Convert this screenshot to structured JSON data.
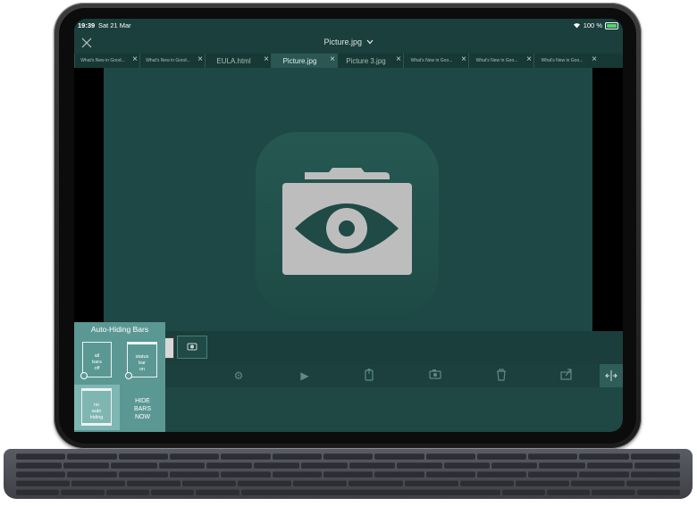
{
  "status_bar": {
    "time": "19:39",
    "date": "Sat 21 Mar",
    "battery": "100 %"
  },
  "header": {
    "title": "Picture.jpg"
  },
  "tabs": [
    {
      "label": "What's New in Good...",
      "size": "small",
      "active": false
    },
    {
      "label": "What's New in Good...",
      "size": "small",
      "active": false
    },
    {
      "label": "EULA.html",
      "size": "big",
      "active": false
    },
    {
      "label": "Picture.jpg",
      "size": "big",
      "active": true
    },
    {
      "label": "Picture 3.jpg",
      "size": "big",
      "active": false
    },
    {
      "label": "What's New in Goo...",
      "size": "small",
      "active": false
    },
    {
      "label": "What's New in Goo...",
      "size": "small",
      "active": false
    },
    {
      "label": "What's New in Goo...",
      "size": "small",
      "active": false
    }
  ],
  "popup": {
    "title": "Auto-Hiding Bars",
    "options": [
      {
        "label_lines": [
          "all",
          "bars",
          "off"
        ]
      },
      {
        "label_lines": [
          "status",
          "bar",
          "on"
        ]
      },
      {
        "label_lines": [
          "no",
          "auto",
          "hiding"
        ]
      },
      {
        "label_lines": [
          "HIDE",
          "BARS",
          "NOW"
        ]
      }
    ]
  },
  "toolbar_icons": [
    "gear-icon",
    "play-icon",
    "phone-transfer-icon",
    "camera-icon",
    "trash-icon",
    "share-icon",
    "resize-icon"
  ],
  "colors": {
    "accent": "#5b9894",
    "screen_bg": "#1e4845",
    "bar_bg": "#1b3f3c"
  }
}
